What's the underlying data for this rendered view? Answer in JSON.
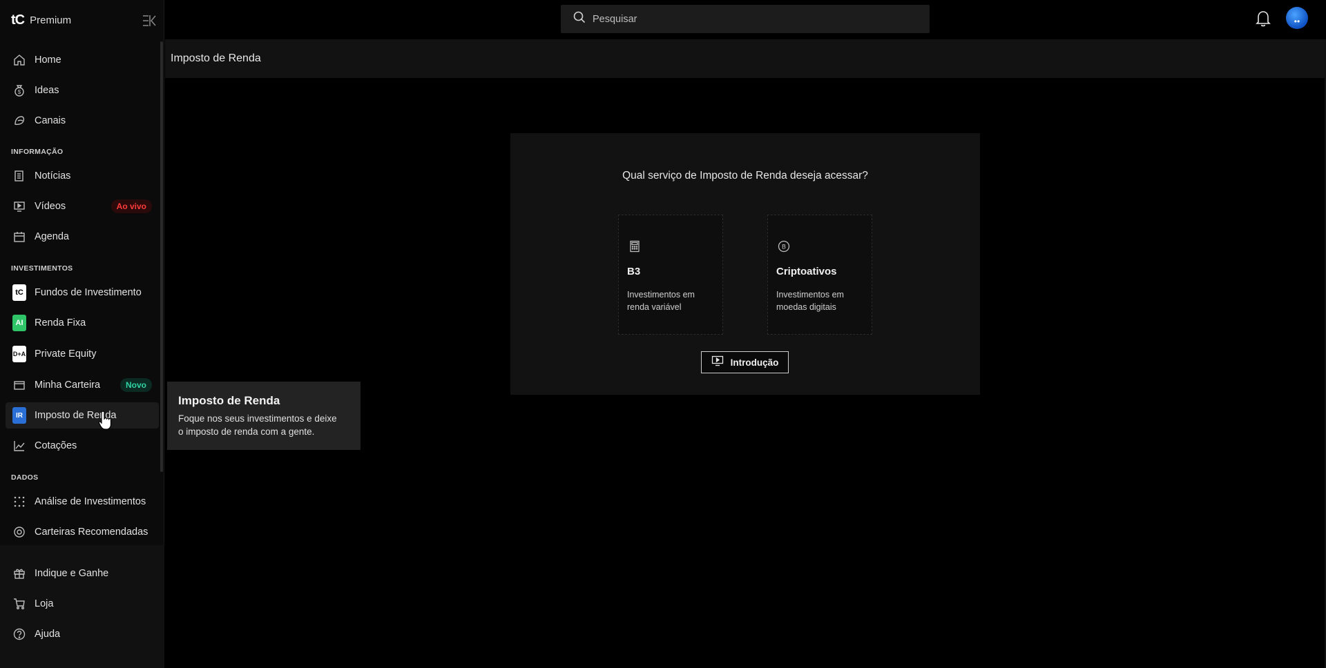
{
  "brand": {
    "logo": "tC",
    "name": "Premium"
  },
  "search": {
    "placeholder": "Pesquisar"
  },
  "sidebar": {
    "main": [
      {
        "label": "Home",
        "icon": "home-icon"
      },
      {
        "label": "Ideas",
        "icon": "money-bag-icon"
      },
      {
        "label": "Canais",
        "icon": "channels-icon"
      }
    ],
    "sections": {
      "info": "INFORMAÇÃO",
      "investments": "INVESTIMENTOS",
      "data": "DADOS"
    },
    "info": [
      {
        "label": "Notícias",
        "icon": "news-icon"
      },
      {
        "label": "Vídeos",
        "icon": "video-icon",
        "badge": "Ao vivo"
      },
      {
        "label": "Agenda",
        "icon": "calendar-icon"
      }
    ],
    "investments": [
      {
        "label": "Fundos de Investimento",
        "logo": "tC"
      },
      {
        "label": "Renda Fixa",
        "logo": "AI"
      },
      {
        "label": "Private Equity",
        "logo": "D+A"
      },
      {
        "label": "Minha Carteira",
        "icon": "wallet-icon",
        "badge": "Novo"
      },
      {
        "label": "Imposto de Renda",
        "icon": "tax-icon"
      },
      {
        "label": "Cotações",
        "icon": "chart-line-icon"
      }
    ],
    "data": [
      {
        "label": "Análise de Investimentos",
        "icon": "dots-grid-icon"
      },
      {
        "label": "Carteiras Recomendadas",
        "icon": "target-icon"
      }
    ],
    "bottom": [
      {
        "label": "Indique e Ganhe",
        "icon": "gift-icon"
      },
      {
        "label": "Loja",
        "icon": "cart-icon"
      },
      {
        "label": "Ajuda",
        "icon": "help-icon"
      }
    ]
  },
  "page": {
    "title": "Imposto de Renda",
    "question": "Qual serviço de Imposto de Renda deseja acessar?",
    "options": [
      {
        "title": "B3",
        "desc1": "Investimentos em",
        "desc2": "renda variável"
      },
      {
        "title": "Criptoativos",
        "desc1": "Investimentos em",
        "desc2": "moedas digitais"
      }
    ],
    "intro_button": "Introdução"
  },
  "tooltip": {
    "title": "Imposto de Renda",
    "body1": "Foque nos seus investimentos e deixe",
    "body2": "o imposto de renda com a gente."
  },
  "colors": {
    "live": "#ff3b3b",
    "new": "#2fd3a5",
    "avatar": "#1e6fe0"
  }
}
